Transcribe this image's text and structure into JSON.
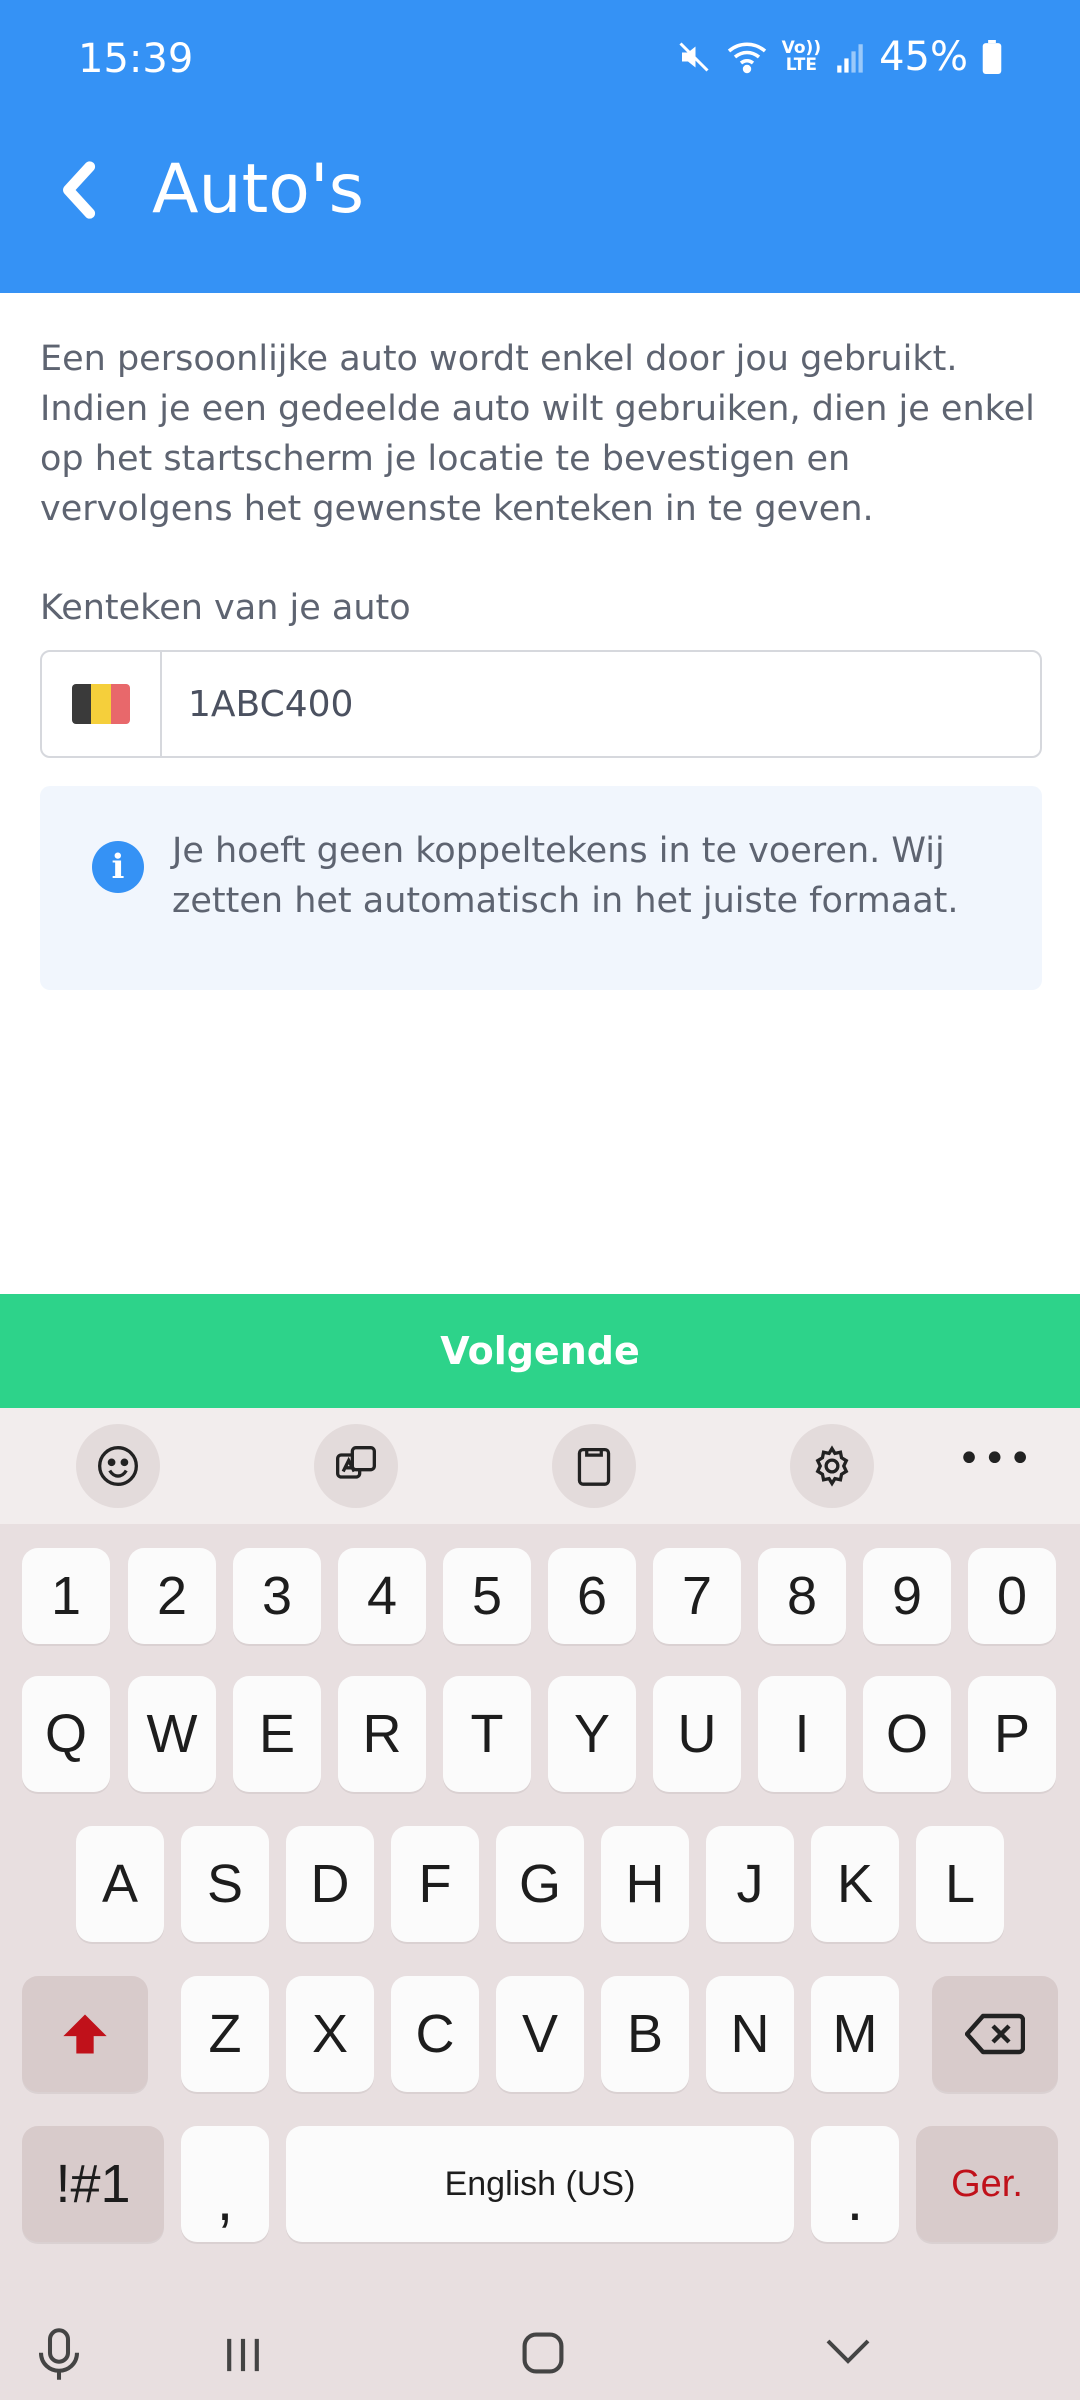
{
  "status": {
    "time": "15:39",
    "lte_top": "Vo))",
    "lte_bottom": "LTE",
    "battery": "45%"
  },
  "appbar": {
    "title": "Auto's"
  },
  "content": {
    "intro": "Een persoonlijke auto wordt enkel door jou gebruikt. Indien je een gedeelde auto wilt gebruiken, dien je enkel op het startscherm je locatie te bevestigen en vervolgens het gewenste kenteken in te geven.",
    "field_label": "Kenteken van je auto",
    "plate_value": "1ABC400",
    "info": "Je hoeft geen koppeltekens in te voeren. Wij zetten het automatisch in het juiste formaat."
  },
  "next_button": "Volgende",
  "keyboard": {
    "row_numbers": [
      "1",
      "2",
      "3",
      "4",
      "5",
      "6",
      "7",
      "8",
      "9",
      "0"
    ],
    "row_1": [
      "Q",
      "W",
      "E",
      "R",
      "T",
      "Y",
      "U",
      "I",
      "O",
      "P"
    ],
    "row_2": [
      "A",
      "S",
      "D",
      "F",
      "G",
      "H",
      "J",
      "K",
      "L"
    ],
    "row_3": [
      "Z",
      "X",
      "C",
      "V",
      "B",
      "N",
      "M"
    ],
    "symbols_key": "!#1",
    "comma_key": ",",
    "space_key": "English (US)",
    "period_key": ".",
    "enter_key": "Ger."
  },
  "colors": {
    "header": "#3592f5",
    "primary_button": "#2dd38a",
    "info_bg": "#f1f6fd",
    "enter_text": "#c0111a"
  }
}
